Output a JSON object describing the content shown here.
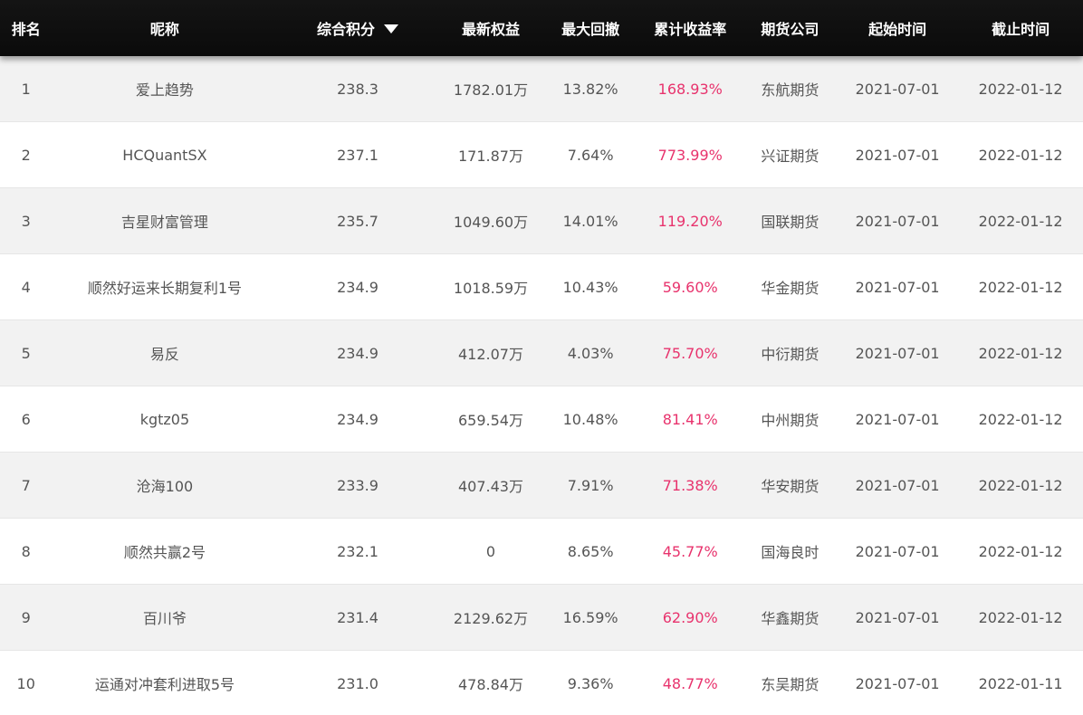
{
  "header": {
    "rank": "排名",
    "name": "昵称",
    "score": "综合积分",
    "equity": "最新权益",
    "drawdown": "最大回撤",
    "return": "累计收益率",
    "company": "期货公司",
    "start": "起始时间",
    "end": "截止时间"
  },
  "colors": {
    "header_bg": "#111111",
    "return_text": "#e8336d",
    "odd_row_bg": "#f2f2f2"
  },
  "rows": [
    {
      "rank": "1",
      "name": "爱上趋势",
      "score": "238.3",
      "equity": "1782.01万",
      "drawdown": "13.82%",
      "return": "168.93%",
      "company": "东航期货",
      "start": "2021-07-01",
      "end": "2022-01-12"
    },
    {
      "rank": "2",
      "name": "HCQuantSX",
      "score": "237.1",
      "equity": "171.87万",
      "drawdown": "7.64%",
      "return": "773.99%",
      "company": "兴证期货",
      "start": "2021-07-01",
      "end": "2022-01-12"
    },
    {
      "rank": "3",
      "name": "吉星财富管理",
      "score": "235.7",
      "equity": "1049.60万",
      "drawdown": "14.01%",
      "return": "119.20%",
      "company": "国联期货",
      "start": "2021-07-01",
      "end": "2022-01-12"
    },
    {
      "rank": "4",
      "name": "顺然好运来长期复利1号",
      "score": "234.9",
      "equity": "1018.59万",
      "drawdown": "10.43%",
      "return": "59.60%",
      "company": "华金期货",
      "start": "2021-07-01",
      "end": "2022-01-12"
    },
    {
      "rank": "5",
      "name": "易反",
      "score": "234.9",
      "equity": "412.07万",
      "drawdown": "4.03%",
      "return": "75.70%",
      "company": "中衍期货",
      "start": "2021-07-01",
      "end": "2022-01-12"
    },
    {
      "rank": "6",
      "name": "kgtz05",
      "score": "234.9",
      "equity": "659.54万",
      "drawdown": "10.48%",
      "return": "81.41%",
      "company": "中州期货",
      "start": "2021-07-01",
      "end": "2022-01-12"
    },
    {
      "rank": "7",
      "name": "沧海100",
      "score": "233.9",
      "equity": "407.43万",
      "drawdown": "7.91%",
      "return": "71.38%",
      "company": "华安期货",
      "start": "2021-07-01",
      "end": "2022-01-12"
    },
    {
      "rank": "8",
      "name": "顺然共赢2号",
      "score": "232.1",
      "equity": "0",
      "drawdown": "8.65%",
      "return": "45.77%",
      "company": "国海良时",
      "start": "2021-07-01",
      "end": "2022-01-12"
    },
    {
      "rank": "9",
      "name": "百川爷",
      "score": "231.4",
      "equity": "2129.62万",
      "drawdown": "16.59%",
      "return": "62.90%",
      "company": "华鑫期货",
      "start": "2021-07-01",
      "end": "2022-01-12"
    },
    {
      "rank": "10",
      "name": "运通对冲套利进取5号",
      "score": "231.0",
      "equity": "478.84万",
      "drawdown": "9.36%",
      "return": "48.77%",
      "company": "东吴期货",
      "start": "2021-07-01",
      "end": "2022-01-11"
    }
  ]
}
